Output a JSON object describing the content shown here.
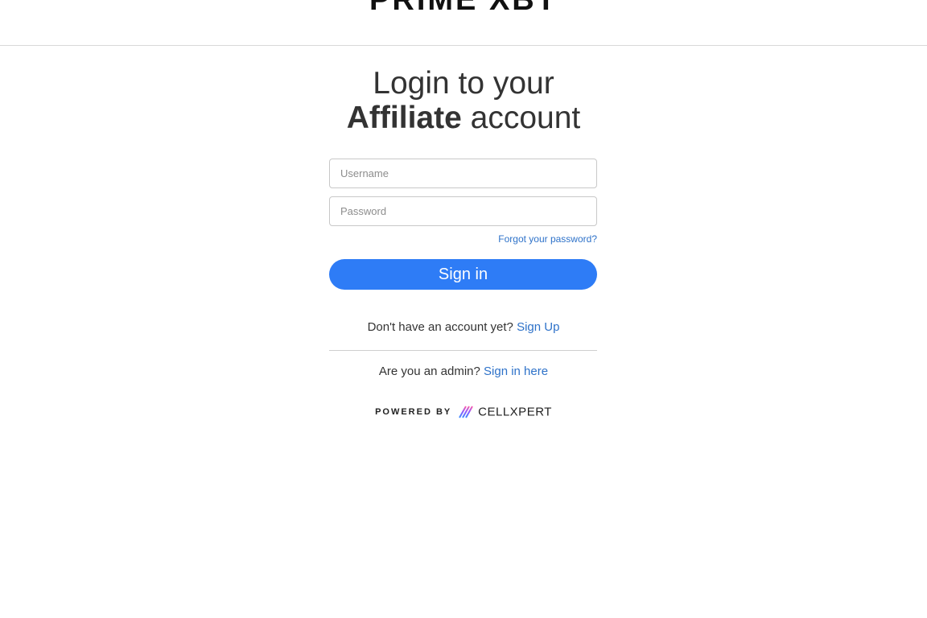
{
  "header": {
    "logo_text": "PRIME XBT"
  },
  "title": {
    "line1": "Login to your",
    "line2_strong": "Affiliate",
    "line2_rest": "account"
  },
  "form": {
    "username_placeholder": "Username",
    "password_placeholder": "Password",
    "forgot_label": "Forgot your password?",
    "signin_label": "Sign in"
  },
  "signup": {
    "prompt": "Don't have an account yet?",
    "link": "Sign Up"
  },
  "admin": {
    "prompt": "Are you an admin?",
    "link": "Sign in here"
  },
  "footer": {
    "powered_by": "POWERED BY",
    "brand": "CELLXPERT",
    "brand_icon": "cellxpert-logo-icon"
  },
  "colors": {
    "primary_button": "#2e7cf6",
    "link": "#2e72c9",
    "brand_icon_gradient": [
      "#3c8cff",
      "#8a5cff",
      "#ff5ca8"
    ]
  }
}
